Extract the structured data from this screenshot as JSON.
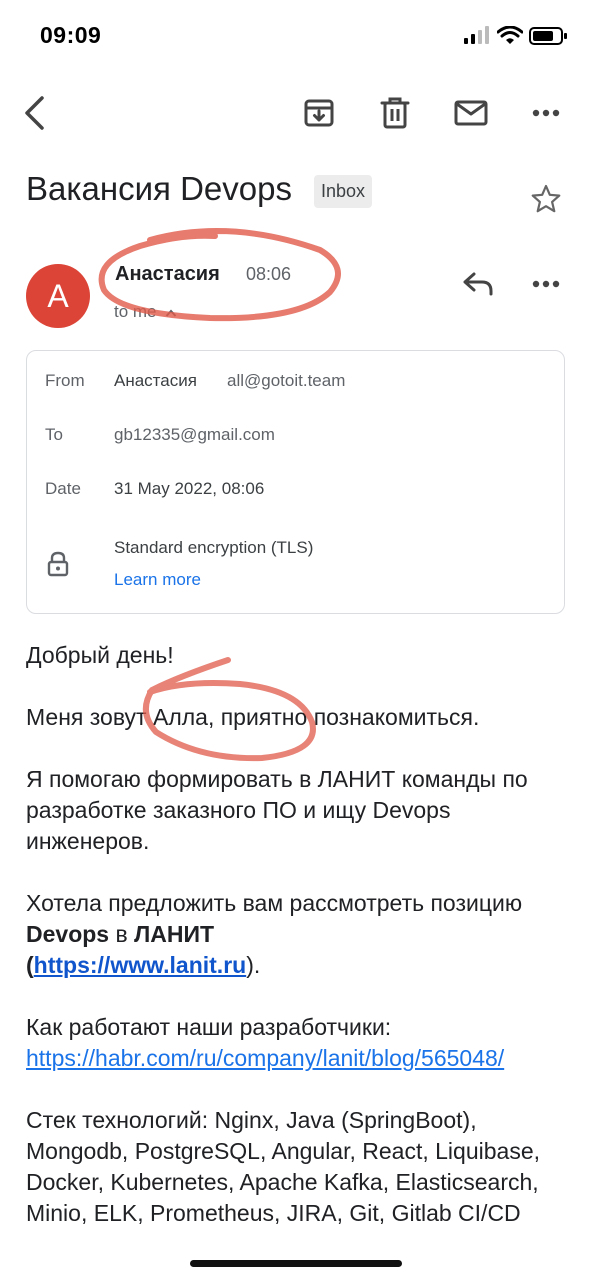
{
  "status_bar": {
    "time": "09:09"
  },
  "email": {
    "subject": "Вакансия Devops",
    "label": "Inbox",
    "avatar_letter": "A",
    "sender_name": "Анастасия",
    "sent_time": "08:06",
    "recipient_summary": "to me",
    "details": {
      "from_label": "From",
      "from_name": "Анастасия",
      "from_email": "all@gotoit.team",
      "to_label": "To",
      "to_value": "gb12335@gmail.com",
      "date_label": "Date",
      "date_value": "31 May 2022, 08:06",
      "encryption": "Standard encryption (TLS)",
      "learn_more": "Learn more"
    },
    "body": {
      "greeting": "Добрый день!",
      "intro": "Меня зовут Алла, приятно познакомиться.",
      "p1": "Я помогаю формировать в ЛАНИТ команды по разработке заказного ПО и ищу Devops инженеров.",
      "p2_a": "Хотела предложить вам рассмотреть позицию ",
      "p2_b": "Devops",
      "p2_c": " в  ",
      "p2_d": "ЛАНИТ",
      "p2_open": "(",
      "p2_link": "https://www.lanit.ru",
      "p2_close": ").",
      "p3_text": "Как работают наши разработчики:",
      "p3_link": "https://habr.com/ru/company/lanit/blog/565048/",
      "p4": "Стек технологий: Nginx, Java (SpringBoot), Mongodb, PostgreSQL, Angular, React, Liquibase, Docker, Kubernetes, Apache Kafka, Elasticsearch, Minio, ELK, Prometheus, JIRA, Git, Gitlab CI/CD"
    }
  },
  "colors": {
    "avatar": "#db4437",
    "link": "#1a73e8",
    "annotation": "#e05a4a"
  },
  "icons": [
    "back-arrow-icon",
    "archive-icon",
    "trash-icon",
    "mail-icon",
    "more-icon",
    "star-icon",
    "reply-icon",
    "lock-icon"
  ]
}
